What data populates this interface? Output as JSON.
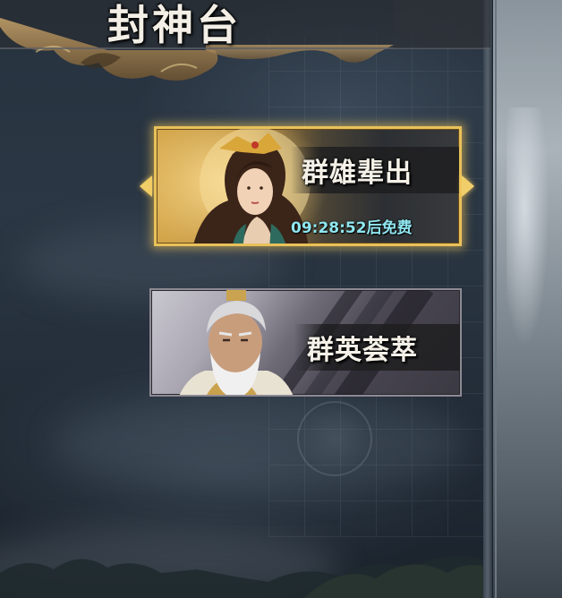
{
  "screen": {
    "title": "封神台"
  },
  "cards": [
    {
      "label": "群雄辈出",
      "timer": "09:28:52后免费",
      "selected": true
    },
    {
      "label": "群英荟萃",
      "selected": false
    }
  ],
  "colors": {
    "selected_border": "#e8c15a",
    "timer_text": "#8fe6f0",
    "label_text": "#f5f1e8"
  }
}
